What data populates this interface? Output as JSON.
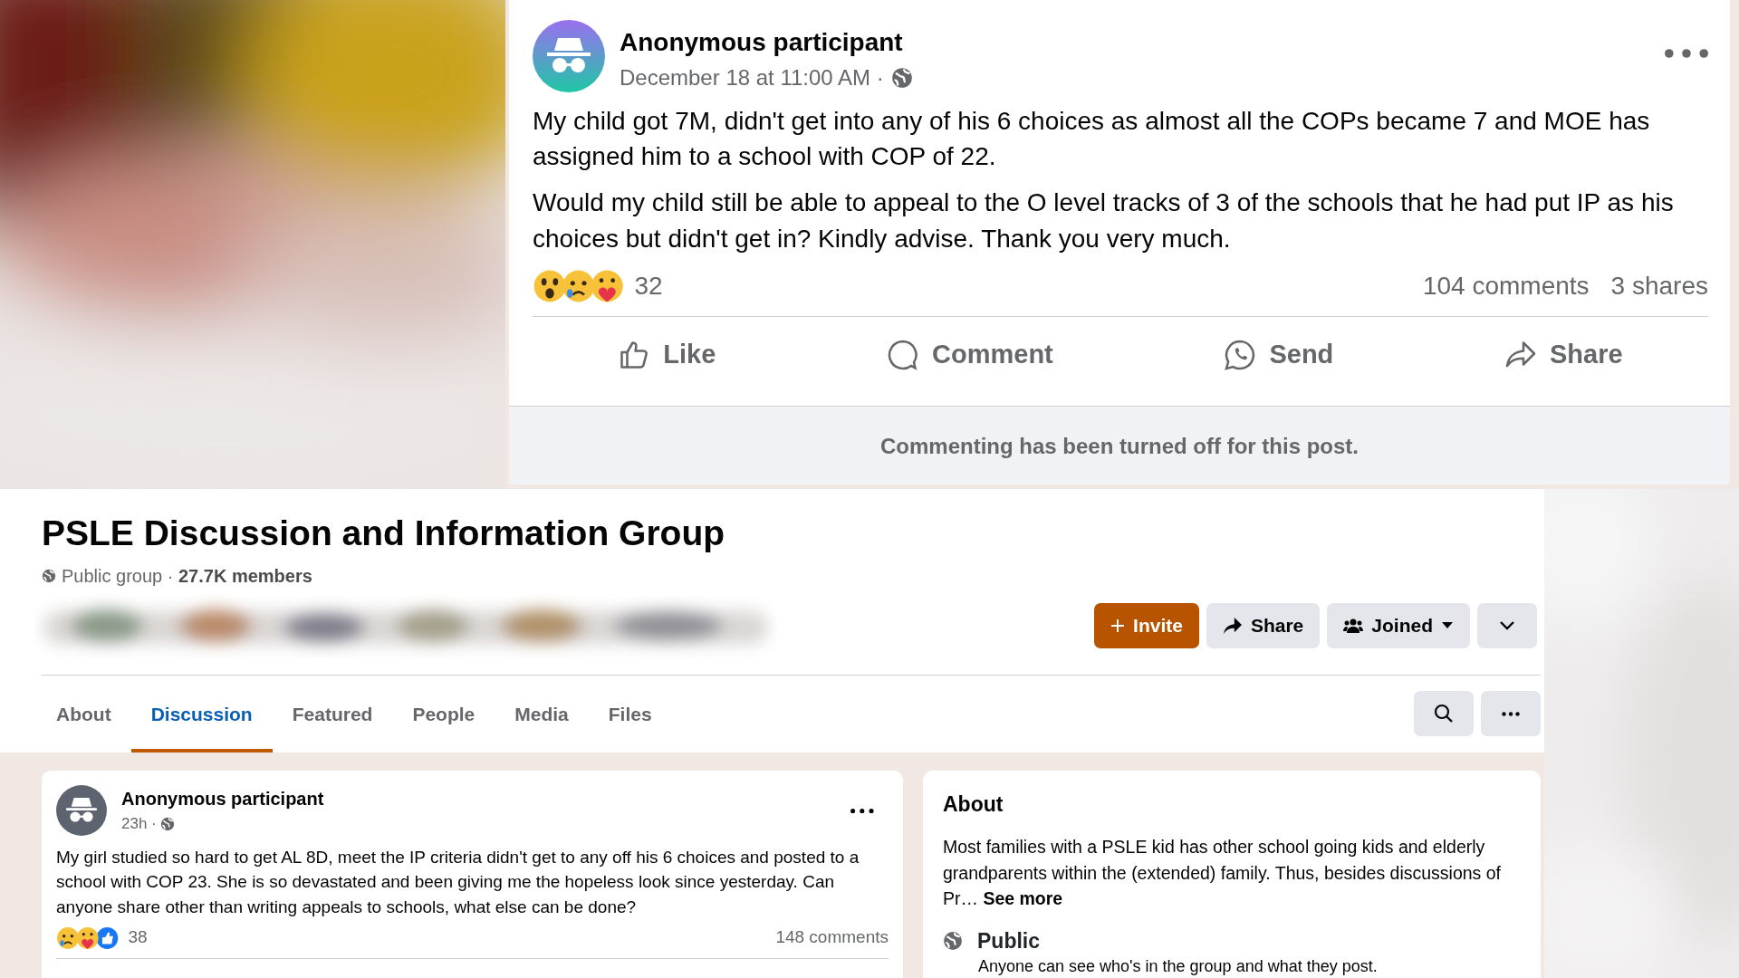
{
  "top_post": {
    "author": "Anonymous participant",
    "timestamp": "December 18 at 11:00 AM ·",
    "paragraphs": [
      "My child got 7M, didn't get into any of his 6 choices as almost all the COPs became 7 and MOE has assigned him to a school with COP of 22.",
      "Would my child still be able to appeal to the O level tracks of 3 of the schools that he had put IP as his choices but didn't get in? Kindly advise. Thank you very much."
    ],
    "reaction_count": "32",
    "comments": "104 comments",
    "shares": "3 shares",
    "actions": [
      {
        "kind": "like",
        "label": "Like"
      },
      {
        "kind": "comment",
        "label": "Comment"
      },
      {
        "kind": "send",
        "label": "Send"
      },
      {
        "kind": "share",
        "label": "Share"
      }
    ],
    "notice": "Commenting has been turned off for this post."
  },
  "group": {
    "title": "PSLE Discussion and Information Group",
    "meta": "Public group · **27.7K members**",
    "buttons": [
      {
        "kind": "invite",
        "label": "Invite"
      },
      {
        "kind": "share",
        "label": "Share"
      },
      {
        "kind": "joined",
        "label": "Joined"
      },
      {
        "kind": "expand"
      }
    ],
    "tabs": [
      {
        "label": "About",
        "selected": false
      },
      {
        "label": "Discussion",
        "selected": true
      },
      {
        "label": "Featured",
        "selected": false
      },
      {
        "label": "People",
        "selected": false
      },
      {
        "label": "Media",
        "selected": false
      },
      {
        "label": "Files",
        "selected": false
      }
    ]
  },
  "feed_post": {
    "author": "Anonymous participant",
    "timestamp": "23h ·",
    "text": "My girl studied so hard to get AL 8D, meet the IP criteria didn't get to any off his 6 choices and posted to a school with COP 23.  She is so devastated and been giving me the hopeless look since yesterday. Can anyone share other than writing appeals to schools, what else can be done?",
    "reaction_count": "38",
    "comments": "148 comments"
  },
  "about": {
    "heading": "About",
    "text": "Most families with a PSLE kid has other school going kids and elderly grandparents within the (extended) family. Thus, besides discussions of Pr…",
    "see_more": "See more",
    "privacy_title": "Public",
    "privacy_text": "Anyone can see who's in the group and what they post."
  }
}
